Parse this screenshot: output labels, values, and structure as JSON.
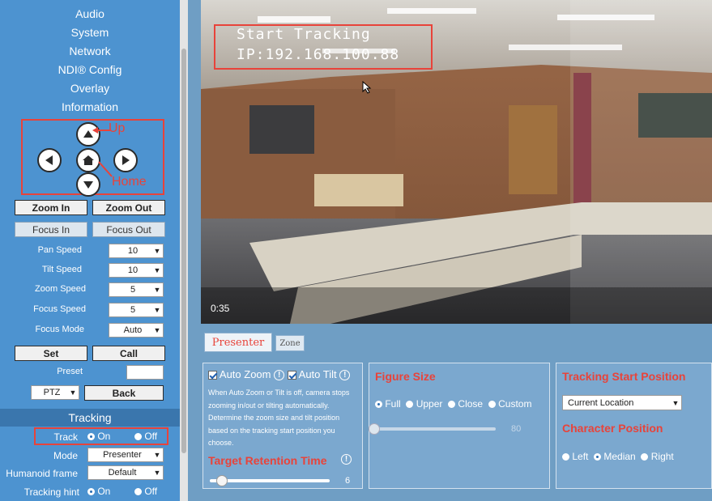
{
  "sidebar": {
    "menu": [
      "Audio",
      "System",
      "Network",
      "NDI® Config",
      "Overlay",
      "Information"
    ],
    "annotations": {
      "up": "Up",
      "home": "Home"
    },
    "buttons": {
      "zoom_in": "Zoom In",
      "zoom_out": "Zoom Out",
      "focus_in": "Focus In",
      "focus_out": "Focus Out",
      "set": "Set",
      "call": "Call",
      "back": "Back"
    },
    "speeds": [
      {
        "label": "Pan Speed",
        "value": "10"
      },
      {
        "label": "Tilt Speed",
        "value": "10"
      },
      {
        "label": "Zoom Speed",
        "value": "5"
      },
      {
        "label": "Focus Speed",
        "value": "5"
      },
      {
        "label": "Focus Mode",
        "value": "Auto"
      }
    ],
    "preset_label": "Preset",
    "preset_value": "",
    "ptz_select": "PTZ",
    "tracking": {
      "header": "Tracking",
      "track_label": "Track",
      "on": "On",
      "off": "Off",
      "mode_label": "Mode",
      "mode_value": "Presenter",
      "humanoid_label": "Humanoid frame",
      "humanoid_value": "Default",
      "hint_label": "Tracking hint",
      "hint_on": "On",
      "hint_off": "Off"
    }
  },
  "video": {
    "overlay_line1": "Start Tracking",
    "overlay_line2": "IP:192.168.100.88",
    "timecode": "0:35"
  },
  "tabs": {
    "presenter": "Presenter",
    "zone": "Zone"
  },
  "panel_zoom": {
    "auto_zoom": "Auto Zoom",
    "auto_tilt": "Auto Tilt",
    "description": "When Auto Zoom or Tilt is off, camera stops zooming in/out or tilting automatically. Determine the zoom size and tilt position based on the tracking start position you choose.",
    "retention_title": "Target Retention Time",
    "retention_value": "6",
    "retention_level": 0.1
  },
  "panel_figure": {
    "title": "Figure Size",
    "options": [
      "Full",
      "Upper",
      "Close",
      "Custom"
    ],
    "selected": "Full",
    "slider_value": "80",
    "slider_level": 0.0
  },
  "panel_tracking": {
    "start_title": "Tracking Start Position",
    "start_value": "Current Location",
    "char_title": "Character Position",
    "options": [
      "Left",
      "Median",
      "Right"
    ],
    "selected": "Median"
  },
  "colors": {
    "accent_red": "#e8433a",
    "sidebar_blue": "#4d93d0",
    "panel_blue": "#7ba8cf"
  }
}
